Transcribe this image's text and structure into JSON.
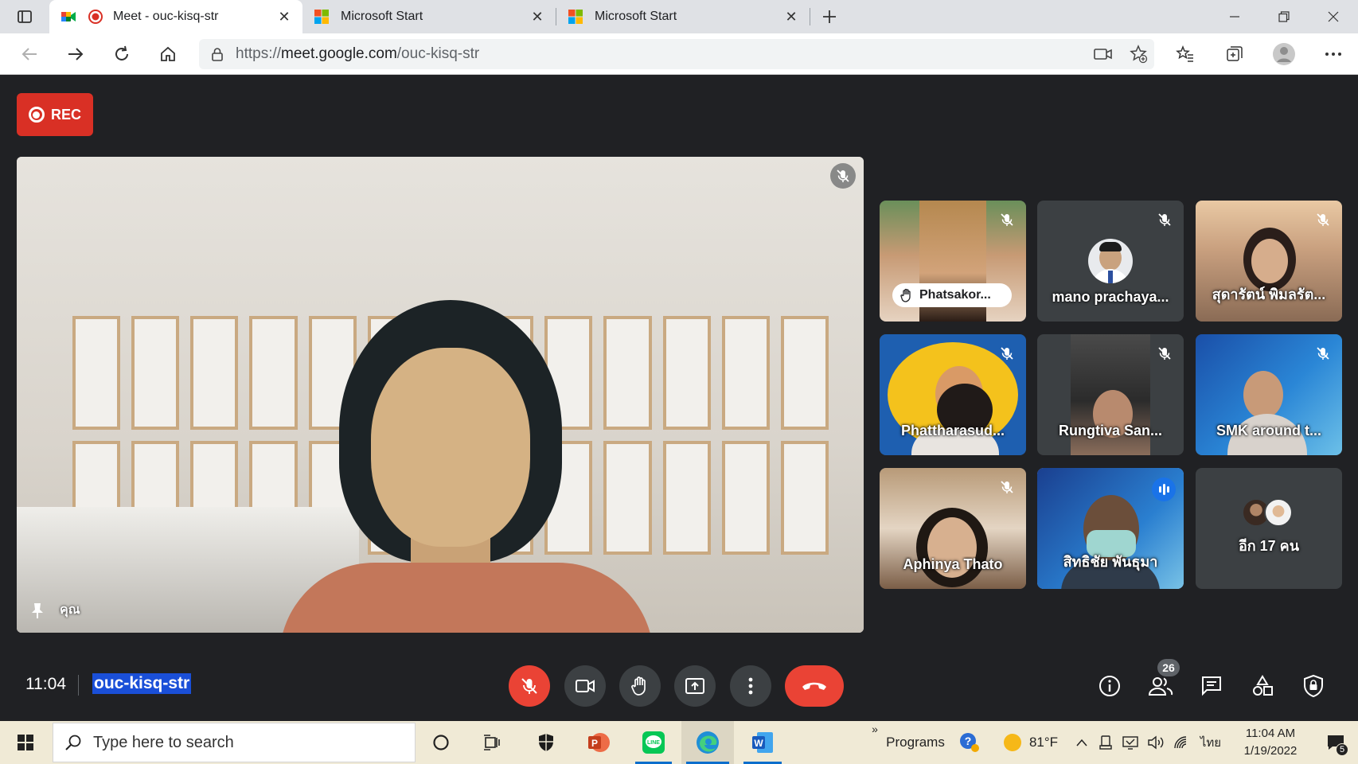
{
  "browser": {
    "tabs": [
      {
        "title": "Meet - ouc-kisq-str",
        "active": true
      },
      {
        "title": "Microsoft Start",
        "active": false
      },
      {
        "title": "Microsoft Start",
        "active": false
      }
    ],
    "url_prefix": "https://",
    "url_host": "meet.google.com",
    "url_path": "/ouc-kisq-str"
  },
  "meet": {
    "rec_label": "REC",
    "self_name": "คุณ",
    "participants": [
      {
        "name": "Phatsakor...",
        "hand_raised": true
      },
      {
        "name": "mano prachaya..."
      },
      {
        "name": "สุดารัตน์ พิมลรัต..."
      },
      {
        "name": "Phattharasud..."
      },
      {
        "name": "Rungtiva San..."
      },
      {
        "name": "SMK around t..."
      },
      {
        "name": "Aphinya Thato"
      },
      {
        "name": "สิทธิชัย พันธุมา",
        "speaking": true
      },
      {
        "name": "อีก 17 คน"
      }
    ],
    "clock": "11:04",
    "meeting_code": "ouc-kisq-str",
    "people_count": "26"
  },
  "taskbar": {
    "search_placeholder": "Type here to search",
    "programs_label": "Programs",
    "temperature": "81°F",
    "language": "ไทย",
    "time": "11:04 AM",
    "date": "1/19/2022",
    "notification_count": "5"
  },
  "colors": {
    "meet_bg": "#202124",
    "red": "#ea4335",
    "highlight": "#1a4fd8",
    "taskbar": "#f0ead6"
  }
}
